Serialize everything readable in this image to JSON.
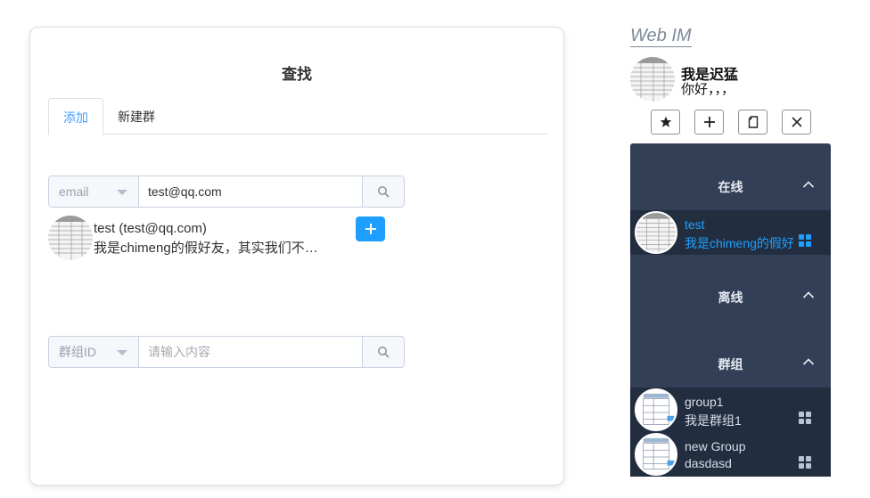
{
  "dialog": {
    "title": "查找",
    "tabs": [
      {
        "label": "添加",
        "active": true
      },
      {
        "label": "新建群",
        "active": false
      }
    ],
    "user_search": {
      "select_value": "email",
      "input_value": "test@qq.com",
      "input_placeholder": "",
      "icon": "search-icon"
    },
    "result": {
      "name": "test (test@qq.com)",
      "sign": "我是chimeng的假好友，其实我们不认识",
      "add_icon": "plus-icon"
    },
    "group_search": {
      "select_value": "群组ID",
      "input_value": "",
      "input_placeholder": "请输入内容",
      "icon": "search-icon"
    }
  },
  "panel": {
    "brand": "Web IM",
    "me": {
      "name": "我是迟猛",
      "sign": "你好，，，"
    },
    "toolbar": [
      {
        "icon": "star-icon"
      },
      {
        "icon": "plus-icon"
      },
      {
        "icon": "document-icon"
      },
      {
        "icon": "close-icon"
      }
    ],
    "groups": {
      "online": {
        "label": "在线",
        "items": [
          {
            "name": "test",
            "sign": "我是chimeng的假好友，其实我们不认识"
          }
        ]
      },
      "offline": {
        "label": "离线",
        "items": []
      },
      "groups": {
        "label": "群组",
        "items": [
          {
            "name": "group1",
            "sign": "我是群组1"
          },
          {
            "name": "new Group",
            "sign": "dasdasd"
          }
        ]
      }
    }
  },
  "colors": {
    "accent": "#1e9fff",
    "sidebar_bg": "#323f57",
    "sidebar_item_bg": "#222e40",
    "tab_active": "#409eff"
  }
}
